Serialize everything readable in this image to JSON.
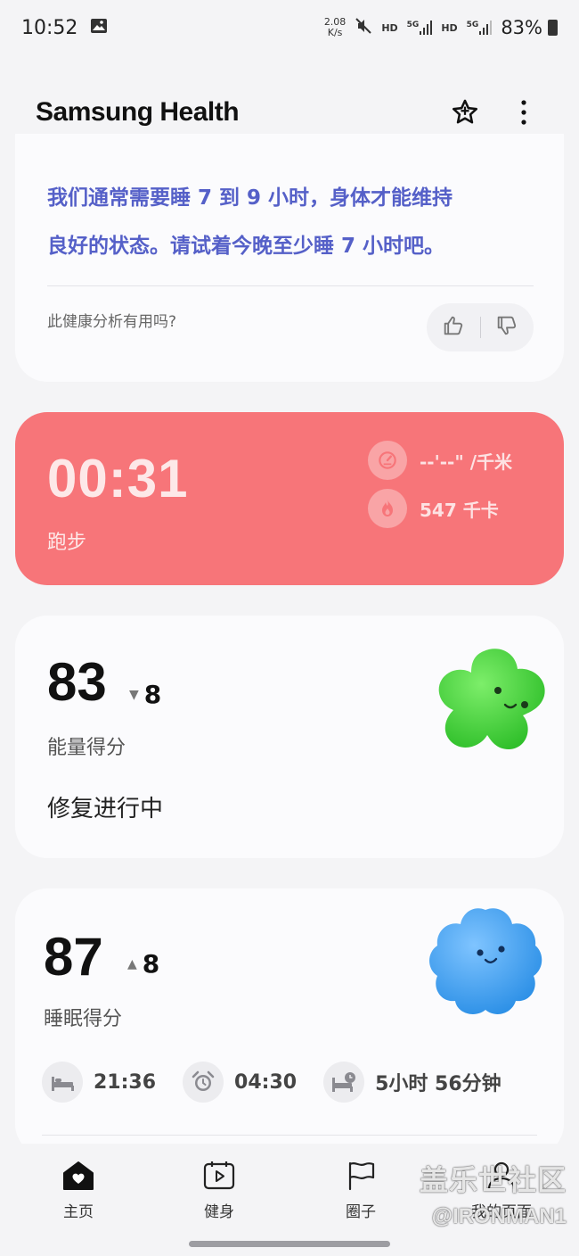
{
  "status_bar": {
    "time": "10:52",
    "speed_value": "2.08",
    "speed_unit": "K/s",
    "hd1": "HD",
    "net1": "5G",
    "hd2": "HD",
    "net2": "5G",
    "battery": "83%"
  },
  "app": {
    "title": "Samsung Health"
  },
  "insight": {
    "text_line1": "我们通常需要睡 7 到 9 小时，身体才能维持",
    "text_line2": "良好的状态。请试着今晚至少睡 7 小时吧。",
    "question": "此健康分析有用吗?"
  },
  "run": {
    "time": "00:31",
    "label": "跑步",
    "pace": "--'--\" /千米",
    "calories": "547 千卡"
  },
  "energy": {
    "score": "83",
    "delta": "8",
    "delta_direction": "down",
    "label": "能量得分",
    "status": "修复进行中"
  },
  "sleep": {
    "score": "87",
    "delta": "8",
    "delta_direction": "up",
    "label": "睡眠得分",
    "bedtime": "21:36",
    "wake_time": "04:30",
    "duration": "5小时 56分钟"
  },
  "nav": {
    "home": "主页",
    "fitness": "健身",
    "together": "圈子",
    "my_page": "我的页面"
  },
  "watermark": {
    "line1": "盖乐世社区",
    "line2": "@IRONMAN1"
  },
  "colors": {
    "accent_text": "#5560c8",
    "run_card": "#f77579",
    "energy_blob": "#4cd645",
    "sleep_blob": "#3d9cf0"
  }
}
